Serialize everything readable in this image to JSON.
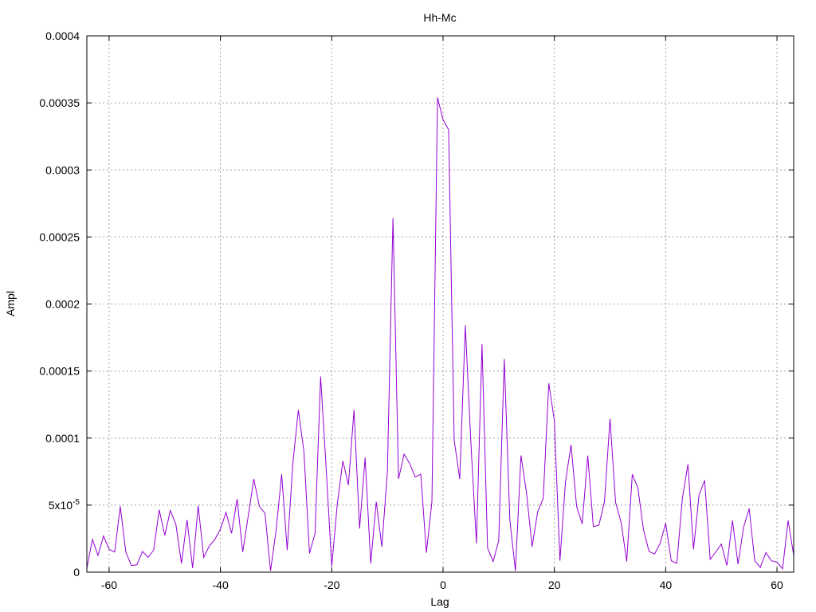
{
  "chart_data": {
    "type": "line",
    "title": "Hh-Mc",
    "xlabel": "Lag",
    "ylabel": "Ampl",
    "xlim": [
      -64,
      63
    ],
    "ylim": [
      0,
      0.0004
    ],
    "grid": true,
    "line_color": "#9400d3",
    "x_ticks": [
      {
        "value": -60,
        "label": "-60"
      },
      {
        "value": -40,
        "label": "-40"
      },
      {
        "value": -20,
        "label": "-20"
      },
      {
        "value": 0,
        "label": "0"
      },
      {
        "value": 20,
        "label": "20"
      },
      {
        "value": 40,
        "label": "40"
      },
      {
        "value": 60,
        "label": "60"
      }
    ],
    "y_ticks": [
      {
        "value": 0,
        "label": "0"
      },
      {
        "value": 5e-05,
        "label": "5x10",
        "sup": "-5"
      },
      {
        "value": 0.0001,
        "label": "0.0001"
      },
      {
        "value": 0.00015,
        "label": "0.00015"
      },
      {
        "value": 0.0002,
        "label": "0.0002"
      },
      {
        "value": 0.00025,
        "label": "0.00025"
      },
      {
        "value": 0.0003,
        "label": "0.0003"
      },
      {
        "value": 0.00035,
        "label": "0.00035"
      },
      {
        "value": 0.0004,
        "label": "0.0004"
      }
    ],
    "series": [
      {
        "x": [
          -64,
          -63,
          -62,
          -61,
          -60,
          -59,
          -58,
          -57,
          -56,
          -55,
          -54,
          -53,
          -52,
          -51,
          -50,
          -49,
          -48,
          -47,
          -46,
          -45,
          -44,
          -43,
          -42,
          -41,
          -40,
          -39,
          -38,
          -37,
          -36,
          -35,
          -34,
          -33,
          -32,
          -31,
          -30,
          -29,
          -28,
          -27,
          -26,
          -25,
          -24,
          -23,
          -22,
          -21,
          -20,
          -19,
          -18,
          -17,
          -16,
          -15,
          -14,
          -13,
          -12,
          -11,
          -10,
          -9,
          -8,
          -7,
          -6,
          -5,
          -4,
          -3,
          -2,
          -1,
          0,
          1,
          2,
          3,
          4,
          5,
          6,
          7,
          8,
          9,
          10,
          11,
          12,
          13,
          14,
          15,
          16,
          17,
          18,
          19,
          20,
          21,
          22,
          23,
          24,
          25,
          26,
          27,
          28,
          29,
          30,
          31,
          32,
          33,
          34,
          35,
          36,
          37,
          38,
          39,
          40,
          41,
          42,
          43,
          44,
          45,
          46,
          47,
          48,
          49,
          50,
          51,
          52,
          53,
          54,
          55,
          56,
          57,
          58,
          59,
          60,
          61,
          62,
          63
        ],
        "y": [
          3e-06,
          2.45e-05,
          1.25e-05,
          2.7e-05,
          1.7e-05,
          1.5e-05,
          4.9e-05,
          1.5e-05,
          5e-06,
          5.5e-06,
          1.55e-05,
          1.1e-05,
          1.65e-05,
          4.65e-05,
          2.75e-05,
          4.6e-05,
          3.55e-05,
          6.5e-06,
          3.9e-05,
          3e-06,
          4.95e-05,
          1.1e-05,
          1.95e-05,
          2.45e-05,
          3.2e-05,
          4.45e-05,
          2.9e-05,
          5.45e-05,
          1.5e-05,
          4.2e-05,
          6.95e-05,
          4.9e-05,
          4.4e-05,
          1e-06,
          3.1e-05,
          7.3e-05,
          1.65e-05,
          8.05e-05,
          0.000121,
          9e-05,
          1.4e-05,
          2.9e-05,
          0.000146,
          7.7e-05,
          4.5e-06,
          5.1e-05,
          8.3e-05,
          6.5e-05,
          0.000121,
          3.25e-05,
          8.55e-05,
          6.5e-06,
          5.25e-05,
          1.9e-05,
          7.5e-05,
          0.000264,
          6.95e-05,
          8.8e-05,
          8.1e-05,
          7.1e-05,
          7.3e-05,
          1.45e-05,
          5.25e-05,
          0.000354,
          0.0003375,
          0.00033,
          9.85e-05,
          6.95e-05,
          0.000184,
          9.65e-05,
          2.15e-05,
          0.00017,
          1.8e-05,
          8e-06,
          2.35e-05,
          0.000159,
          3.9e-05,
          1e-06,
          8.7e-05,
          5.9e-05,
          1.9e-05,
          4.5e-05,
          5.5e-05,
          0.000141,
          0.000113,
          8.5e-06,
          6.75e-05,
          9.5e-05,
          4.9e-05,
          3.6e-05,
          8.7e-05,
          3.4e-05,
          3.5e-05,
          5.25e-05,
          0.0001145,
          5.2e-05,
          3.7e-05,
          8e-06,
          7.3e-05,
          6.3e-05,
          3.2e-05,
          1.55e-05,
          1.35e-05,
          2.15e-05,
          3.65e-05,
          8.5e-06,
          6.5e-06,
          5.5e-05,
          8.05e-05,
          1.7e-05,
          5.75e-05,
          6.85e-05,
          9.5e-06,
          1.5e-05,
          2.1e-05,
          5e-06,
          3.85e-05,
          6e-06,
          3.35e-05,
          4.75e-05,
          8.5e-06,
          3.5e-06,
          1.45e-05,
          8.5e-06,
          7.5e-06,
          2.5e-06,
          3.85e-05,
          1.25e-05
        ]
      }
    ]
  }
}
